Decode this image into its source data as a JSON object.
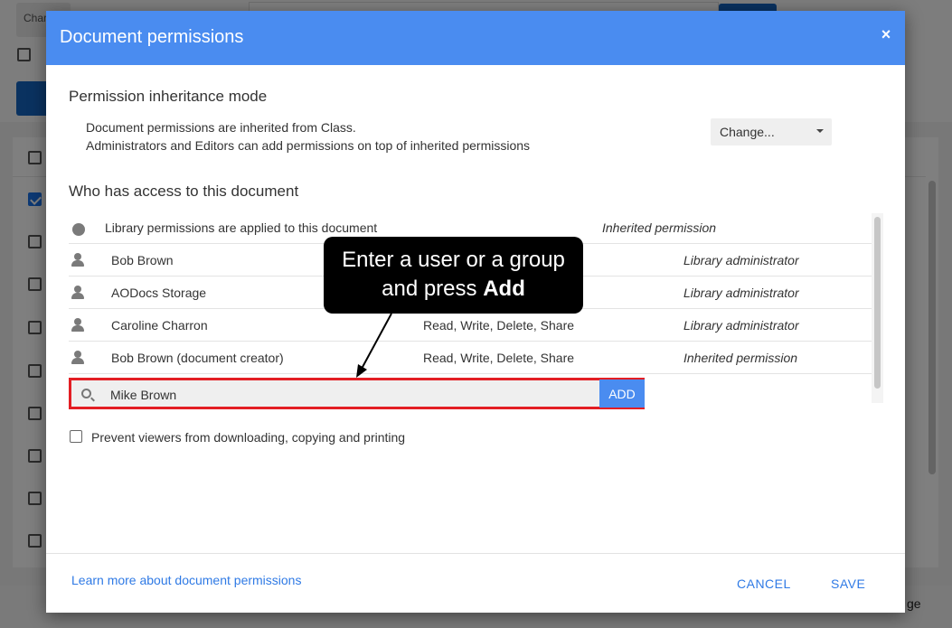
{
  "background": {
    "chip_text": "Char",
    "footer_text": "ge"
  },
  "dialog": {
    "title": "Document permissions",
    "close_symbol": "×",
    "inheritance": {
      "heading": "Permission inheritance mode",
      "line1": "Document permissions are inherited from Class.",
      "line2": "Administrators and Editors can add permissions on top of inherited permissions",
      "change_label": "Change..."
    },
    "access": {
      "heading": "Who has access to this document",
      "rows": [
        {
          "icon": "globe-icon",
          "name": "Library permissions are applied to this document",
          "permissions": "",
          "role": "Inherited permission"
        },
        {
          "icon": "person-icon",
          "name": "Bob Brown",
          "permissions": "",
          "role": "Library administrator"
        },
        {
          "icon": "person-icon",
          "name": "AODocs Storage",
          "permissions": "",
          "role": "Library administrator"
        },
        {
          "icon": "person-icon",
          "name": "Caroline Charron",
          "permissions": "Read, Write, Delete, Share",
          "role": "Library administrator"
        },
        {
          "icon": "person-icon",
          "name": "Bob Brown (document creator)",
          "permissions": "Read, Write, Delete, Share",
          "role": "Inherited permission"
        }
      ]
    },
    "search": {
      "value": "Mike Brown",
      "add_label": "ADD"
    },
    "prevent_label": "Prevent viewers from downloading, copying and printing",
    "learn_more": "Learn more about document permissions",
    "cancel_label": "CANCEL",
    "save_label": "SAVE"
  },
  "callout": {
    "line1": "Enter a user or a group",
    "line2_prefix": "and press ",
    "line2_bold": "Add"
  },
  "colors": {
    "header": "#4a8cf0",
    "highlight": "#e31e24",
    "link": "#2f7ae5"
  }
}
